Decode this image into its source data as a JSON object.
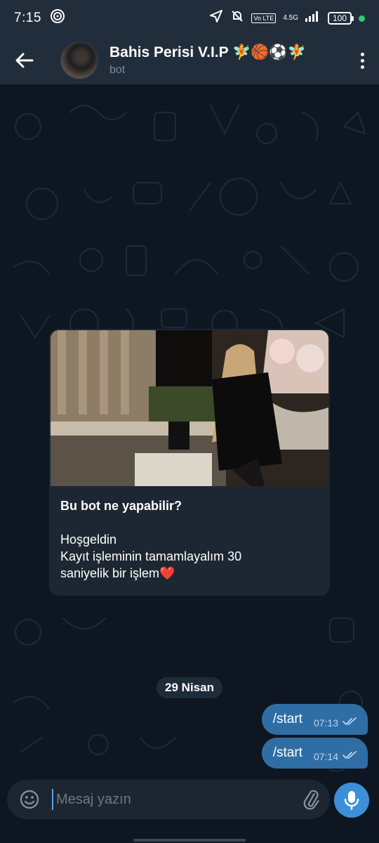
{
  "status_bar": {
    "time": "7:15",
    "network_badge": "Vo LTE",
    "signal_label": "4.5G",
    "battery": "100"
  },
  "header": {
    "title": "Bahis Perisi V.I.P 🧚🏀⚽🧚",
    "subtitle": "bot"
  },
  "bot_card": {
    "title": "Bu bot ne yapabilir?",
    "greeting": "Hoşgeldin",
    "body_line1": "Kayıt işleminin tamamlayalım 30",
    "body_line2": "saniyelik bir işlem❤️"
  },
  "date_divider": "29 Nisan",
  "messages": [
    {
      "text": "/start",
      "time": "07:13",
      "status": "read"
    },
    {
      "text": "/start",
      "time": "07:14",
      "status": "read"
    }
  ],
  "composer": {
    "placeholder": "Mesaj yazın"
  },
  "colors": {
    "header_bg": "#212d3b",
    "chat_bg": "#0e1721",
    "outgoing_bubble": "#2f6ea5",
    "mic_button": "#3d8fd9",
    "online_dot": "#2ecc71"
  }
}
